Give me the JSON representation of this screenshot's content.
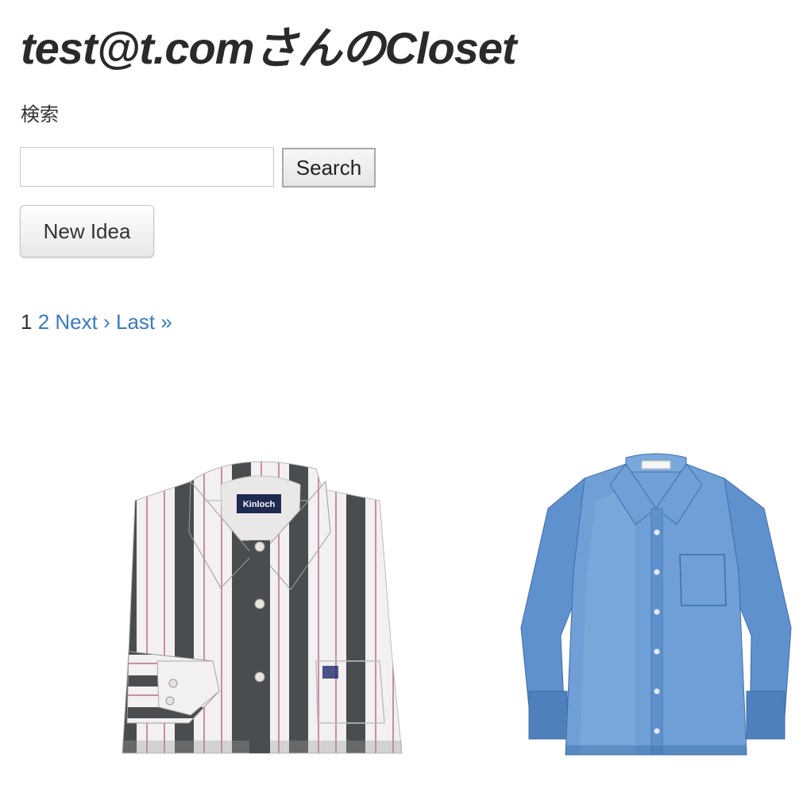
{
  "header": {
    "title": "test@t.comさんのCloset"
  },
  "search": {
    "label": "検索",
    "input_value": "",
    "placeholder": "",
    "button_label": "Search"
  },
  "actions": {
    "new_idea_label": "New Idea"
  },
  "pagination": {
    "current": "1",
    "page2": "2",
    "next": "Next ›",
    "last": "Last »"
  },
  "items": [
    {
      "brand_label": "Kinloch",
      "icon": "striped-shirt-image",
      "colors": {
        "stripe": "#4a4d50",
        "base": "#f2f0f0",
        "pinstripe": "#c98ca8"
      }
    },
    {
      "icon": "blue-oxford-shirt-image",
      "colors": {
        "base": "#6f9fd6",
        "shade": "#4e80bd",
        "highlight": "#8fb6e3"
      }
    }
  ],
  "colors": {
    "link": "#3a7bbf",
    "text": "#333333"
  }
}
